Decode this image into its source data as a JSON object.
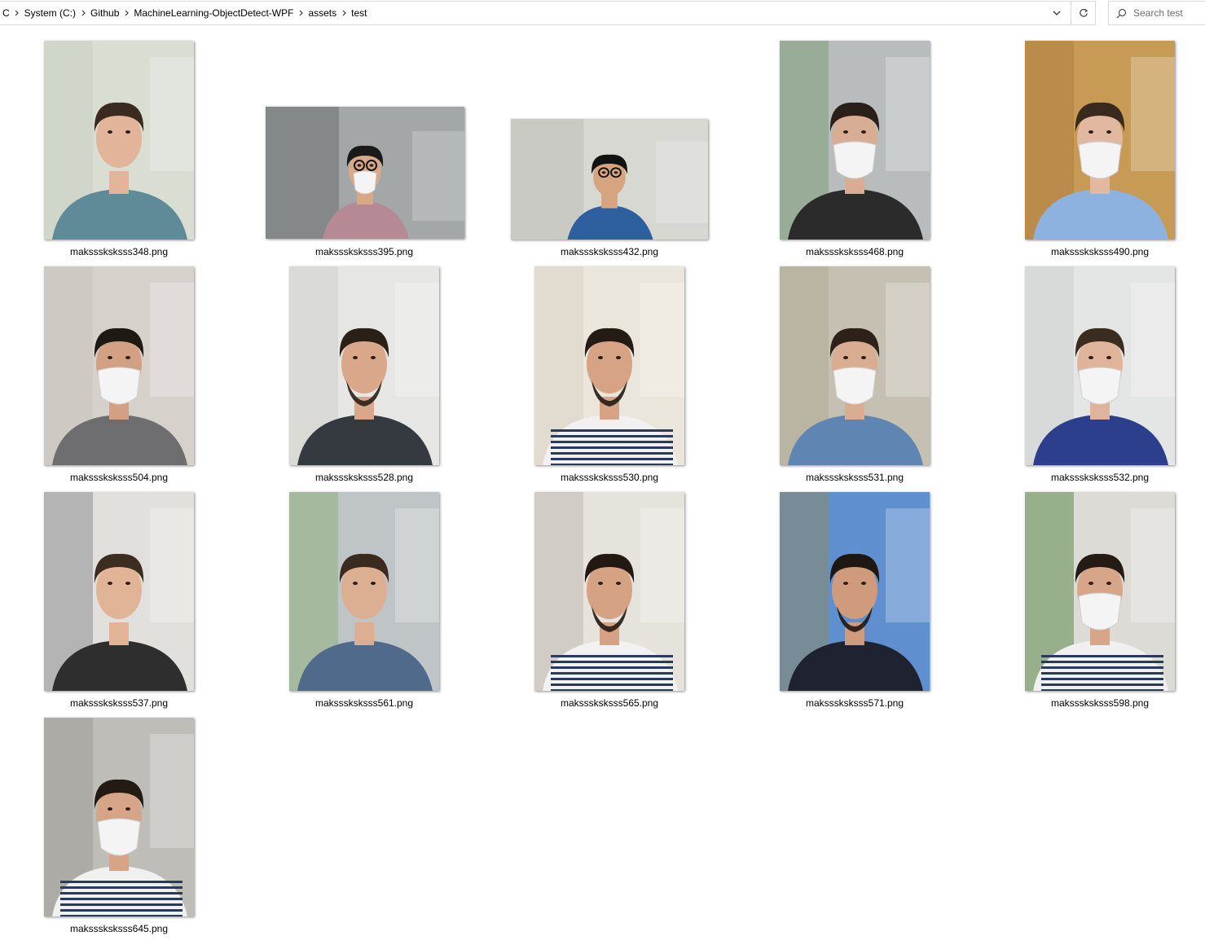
{
  "address_bar": {
    "crumbs": [
      "C",
      "System (C:)",
      "Github",
      "MachineLearning-ObjectDetect-WPF",
      "assets",
      "test"
    ],
    "dropdown_icon": "chevron-down-icon",
    "refresh_icon": "refresh-icon"
  },
  "search": {
    "placeholder": "Search test",
    "icon": "search-icon"
  },
  "files": [
    {
      "name": "maksssksksss348.png",
      "orientation": "portrait",
      "bg": "#d9ddd2",
      "wall": "#c8cfc2",
      "shirt": "#5f8a98",
      "skin": "#e2b49a",
      "hair": "#3a2a1f",
      "mask": false
    },
    {
      "name": "maksssksksss395.png",
      "orientation": "landscape",
      "bg": "#a3a7a8",
      "wall": "#6f7375",
      "shirt": "#b58a95",
      "skin": "#d9a887",
      "hair": "#1a1a1a",
      "mask": true,
      "glasses": true
    },
    {
      "name": "maksssksksss432.png",
      "orientation": "landscape-small",
      "bg": "#d8d8d2",
      "wall": "#c2c2ba",
      "shirt": "#2e5f9e",
      "skin": "#d6a47e",
      "hair": "#121212",
      "mask": false,
      "glasses": true
    },
    {
      "name": "maksssksksss468.png",
      "orientation": "portrait",
      "bg": "#b9bcbd",
      "wall": "#7f9f7a",
      "shirt": "#2b2b2b",
      "skin": "#d8ad93",
      "hair": "#2a2019",
      "mask": true
    },
    {
      "name": "maksssksksss490.png",
      "orientation": "portrait",
      "bg": "#c79a55",
      "wall": "#b08045",
      "shirt": "#8db2e0",
      "skin": "#e2b8a0",
      "hair": "#3a2a1d",
      "mask": true
    },
    {
      "name": "maksssksksss504.png",
      "orientation": "portrait",
      "bg": "#d7d1cc",
      "wall": "#c9c2bd",
      "shirt": "#6e6e70",
      "skin": "#d2a184",
      "hair": "#1f1914",
      "mask": true
    },
    {
      "name": "maksssksksss528.png",
      "orientation": "portrait",
      "bg": "#e6e6e4",
      "wall": "#cfcfcc",
      "shirt": "#343a40",
      "skin": "#d9a88a",
      "hair": "#2b2018",
      "mask": false,
      "beard": true
    },
    {
      "name": "maksssksksss530.png",
      "orientation": "portrait",
      "bg": "#ebe6db",
      "wall": "#d8d2c6",
      "shirt": "#f1f1f1",
      "skin": "#d6a385",
      "hair": "#241b14",
      "mask": false,
      "beard": true,
      "stripes": true
    },
    {
      "name": "maksssksksss531.png",
      "orientation": "portrait",
      "bg": "#c6c0b2",
      "wall": "#b0a998",
      "shirt": "#5f86b3",
      "skin": "#d9ad92",
      "hair": "#2d2119",
      "mask": true
    },
    {
      "name": "maksssksksss532.png",
      "orientation": "portrait",
      "bg": "#e4e5e5",
      "wall": "#cdcfcf",
      "shirt": "#2c3f8c",
      "skin": "#e0b49a",
      "hair": "#3b2c20",
      "mask": true
    },
    {
      "name": "maksssksksss537.png",
      "orientation": "portrait",
      "bg": "#e2e0dc",
      "wall": "#8c8f92",
      "shirt": "#2e2e2e",
      "skin": "#e2b497",
      "hair": "#3d2d20",
      "mask": false
    },
    {
      "name": "maksssksksss561.png",
      "orientation": "portrait",
      "bg": "#bfc4c6",
      "wall": "#8fb07e",
      "shirt": "#4f6a8a",
      "skin": "#dcae92",
      "hair": "#3b2b1f",
      "mask": false
    },
    {
      "name": "maksssksksss565.png",
      "orientation": "portrait",
      "bg": "#e6e3dd",
      "wall": "#bfbab0",
      "shirt": "#f2f2f2",
      "skin": "#d6a284",
      "hair": "#221912",
      "mask": false,
      "beard": true,
      "stripes": true
    },
    {
      "name": "maksssksksss571.png",
      "orientation": "portrait",
      "bg": "#5f8fcf",
      "wall": "#8a8a6a",
      "shirt": "#1f2230",
      "skin": "#d09b7c",
      "hair": "#1e1812",
      "mask": false,
      "beard": true
    },
    {
      "name": "maksssksksss598.png",
      "orientation": "portrait",
      "bg": "#dcdbd6",
      "wall": "#5f8a4f",
      "shirt": "#f0f0f0",
      "skin": "#d7a689",
      "hair": "#241b14",
      "mask": true,
      "stripes": true
    },
    {
      "name": "maksssksksss645.png",
      "orientation": "portrait",
      "bg": "#bfbdb8",
      "wall": "#9f9c97",
      "shirt": "#f0f0f0",
      "skin": "#d6a487",
      "hair": "#231a13",
      "mask": true,
      "stripes": true
    }
  ]
}
